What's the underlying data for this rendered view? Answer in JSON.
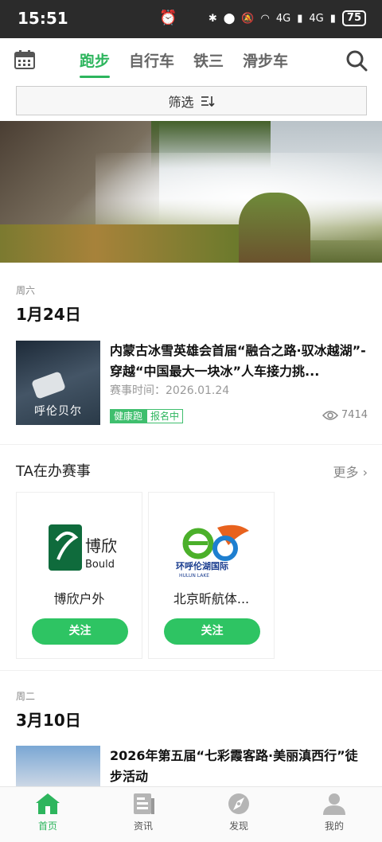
{
  "status": {
    "time": "15:51",
    "battery": "75",
    "net1": "4G",
    "net2": "4G",
    "signal_icon": "signal-icon",
    "wifi_icon": "wifi-icon"
  },
  "nav": {
    "tabs": [
      {
        "label": "跑步",
        "active": true
      },
      {
        "label": "自行车",
        "active": false
      },
      {
        "label": "铁三",
        "active": false
      },
      {
        "label": "滑步车",
        "active": false
      }
    ]
  },
  "filter": {
    "label": "筛选"
  },
  "groups": [
    {
      "weekday": "周六",
      "date": "1月24日",
      "event": {
        "thumb_text": "呼伦贝尔",
        "title": "内蒙古冰雪英雄会首届“融合之路·驭冰越湖”-穿越“中国最大一块冰”人车接力挑...",
        "time": "赛事时间：2026.01.24",
        "tag1": "健康跑",
        "tag2": "报名中",
        "views": "7414"
      }
    },
    {
      "weekday": "周二",
      "date": "3月10日",
      "event": {
        "title": "2026年第五届“七彩霞客路·美丽滇西行”徒步活动"
      }
    }
  ],
  "organizers": {
    "title": "TA在办赛事",
    "more": "更多",
    "cards": [
      {
        "name": "博欣户外",
        "follow": "关注",
        "logo_text": "博欣",
        "logo_sub": "Bould"
      },
      {
        "name": "北京昕航体...",
        "follow": "关注",
        "logo_text": "环呼伦湖国际",
        "logo_sub": "HULUN LAKE"
      }
    ]
  },
  "bottom_nav": [
    {
      "label": "首页",
      "icon": "home-icon",
      "active": true
    },
    {
      "label": "资讯",
      "icon": "news-icon",
      "active": false
    },
    {
      "label": "发现",
      "icon": "discover-icon",
      "active": false
    },
    {
      "label": "我的",
      "icon": "profile-icon",
      "active": false
    }
  ],
  "colors": {
    "accent": "#2db55d",
    "follow_button": "#2ec463"
  }
}
